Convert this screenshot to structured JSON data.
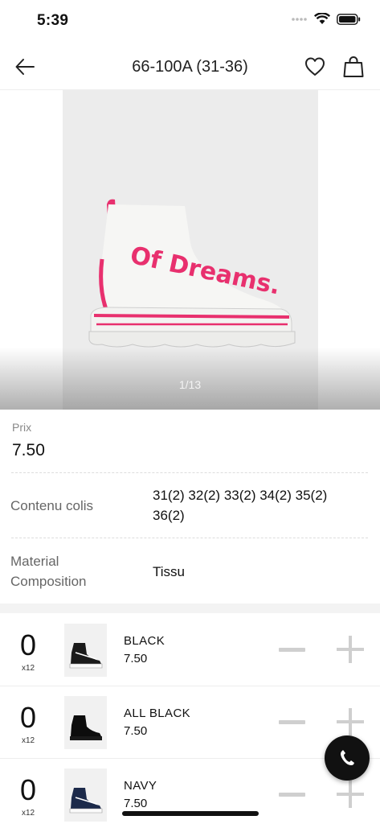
{
  "status_bar": {
    "time": "5:39"
  },
  "nav": {
    "title": "66-100A (31-36)",
    "icons": [
      "back-arrow-icon",
      "heart-icon",
      "shopping-bag-icon"
    ]
  },
  "gallery": {
    "counter": "1/13",
    "image_text": "Of Dreams."
  },
  "details": {
    "price_label": "Prix",
    "price_value": "7.50",
    "package_label": "Contenu colis",
    "package_value_line1": "31(2) 32(2) 33(2) 34(2) 35(2)",
    "package_value_line2": "36(2)",
    "material_label_line1": "Material",
    "material_label_line2": "Composition",
    "material_value": "Tissu"
  },
  "variants": [
    {
      "qty": "0",
      "pack": "x12",
      "name": "BLACK",
      "price": "7.50",
      "thumb_color": "#1a1a1a"
    },
    {
      "qty": "0",
      "pack": "x12",
      "name": "ALL BLACK",
      "price": "7.50",
      "thumb_color": "#0d0d0d"
    },
    {
      "qty": "0",
      "pack": "x12",
      "name": "NAVY",
      "price": "7.50",
      "thumb_color": "#1c2a4a"
    }
  ],
  "colors": {
    "accent": "#e8306e",
    "fab": "#111111"
  }
}
